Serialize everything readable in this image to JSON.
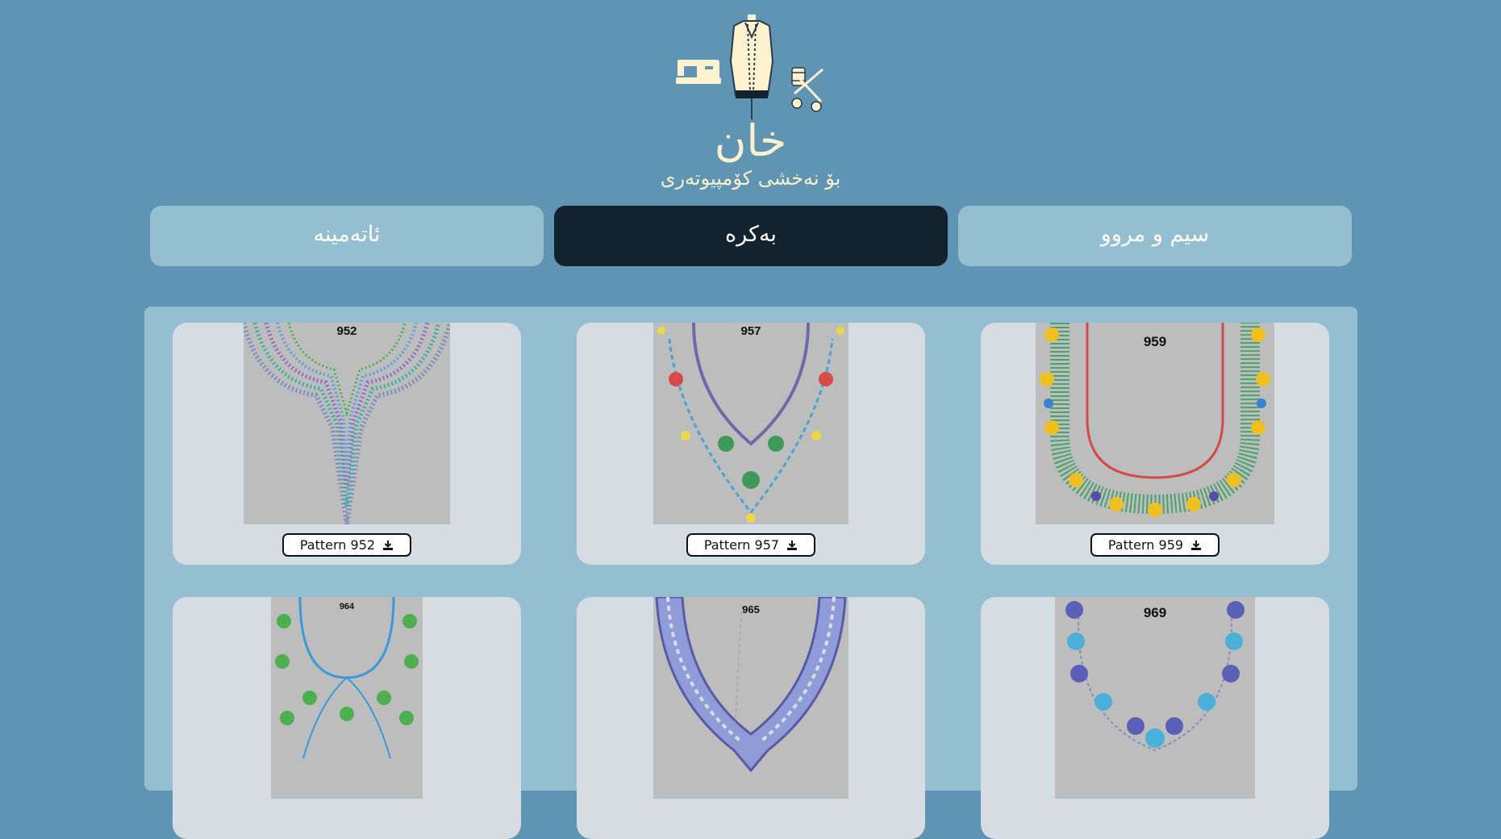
{
  "brand": {
    "title": "خان",
    "subtitle": "بۆ نەخشی کۆمپیوتەری",
    "logo_icons": [
      "sewing-machine-icon",
      "tailor-mannequin-icon",
      "scissors-thread-icon"
    ]
  },
  "nav": {
    "tabs": [
      {
        "label": "ئاتەمینە",
        "active": false
      },
      {
        "label": "بەکرە",
        "active": true
      },
      {
        "label": "سیم و مروو",
        "active": false
      }
    ]
  },
  "colors": {
    "background": "#5f94b3",
    "nav_tab": "#95bfd1",
    "nav_tab_active": "#13222f",
    "brand_text": "#fdf2cf",
    "card": "#d5dde3"
  },
  "patterns": [
    {
      "number": "952",
      "button_label": "Pattern 952",
      "icon": "download-icon"
    },
    {
      "number": "957",
      "button_label": "Pattern 957",
      "icon": "download-icon"
    },
    {
      "number": "959",
      "button_label": "Pattern 959",
      "icon": "download-icon"
    },
    {
      "number": "964",
      "button_label": "",
      "icon": ""
    },
    {
      "number": "965",
      "button_label": "",
      "icon": ""
    },
    {
      "number": "969",
      "button_label": "",
      "icon": ""
    }
  ]
}
